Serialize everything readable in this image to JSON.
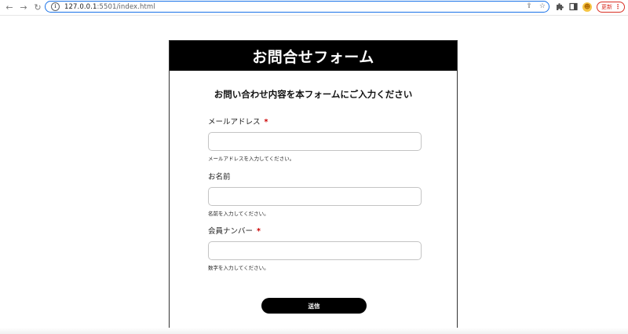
{
  "browser": {
    "url_host": "127.0.0.1",
    "url_path": ":5501/index.html",
    "update_label": "更新"
  },
  "form": {
    "title": "お問合せフォーム",
    "subtitle": "お問い合わせ内容を本フォームにご入力ください",
    "fields": [
      {
        "label": "メールアドレス",
        "required_mark": "*",
        "value": "",
        "help": "メールアドレスを入力してください。"
      },
      {
        "label": "お名前",
        "value": "",
        "help": "名前を入力してください。"
      },
      {
        "label": "会員ナンバー",
        "required_mark": "*",
        "value": "",
        "help": "数字を入力してください。"
      }
    ],
    "submit_label": "送信"
  }
}
